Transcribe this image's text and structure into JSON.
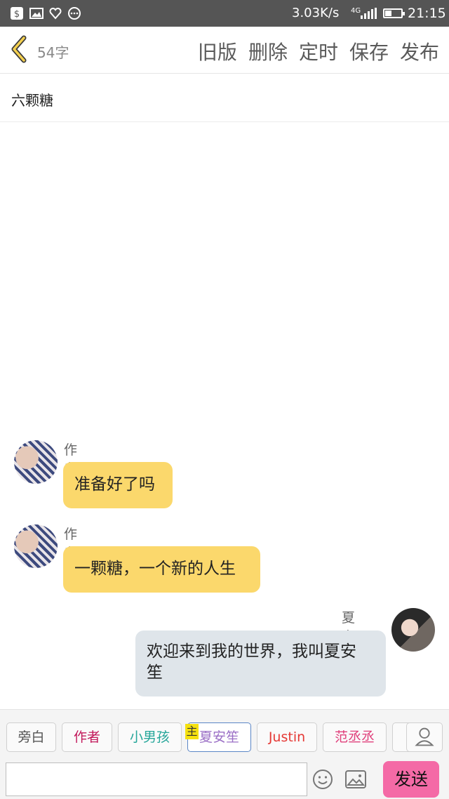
{
  "status": {
    "speed": "3.03K/s",
    "network": "4G",
    "time": "21:15"
  },
  "toolbar": {
    "word_count": "54字",
    "actions": [
      "旧版",
      "删除",
      "定时",
      "保存",
      "发布"
    ]
  },
  "story": {
    "title": "六颗糖"
  },
  "messages": [
    {
      "speaker": "作者",
      "text": "准备好了吗",
      "side": "left"
    },
    {
      "speaker": "作者",
      "text": "一颗糖，一个新的人生",
      "side": "left"
    },
    {
      "speaker": "夏安笙",
      "text_line1": "欢迎来到我的世界，我叫夏安",
      "text_line2": "笙",
      "side": "right"
    }
  ],
  "roles": {
    "chips": [
      {
        "label": "旁白",
        "color": "#555555"
      },
      {
        "label": "作者",
        "color": "#c2185b"
      },
      {
        "label": "小男孩",
        "color": "#26a69a"
      },
      {
        "label": "夏安笙",
        "color": "#9b6fc6"
      },
      {
        "label": "Justin",
        "color": "#e53935"
      },
      {
        "label": "范丞丞",
        "color": "#e0407b"
      }
    ],
    "main_mark": "主",
    "selected": "夏安笙"
  },
  "composer": {
    "send_label": "发送",
    "placeholder": ""
  },
  "colors": {
    "accent": "#f46aa6",
    "left_bubble": "#fbd86c",
    "right_bubble": "#dfe5ea"
  }
}
